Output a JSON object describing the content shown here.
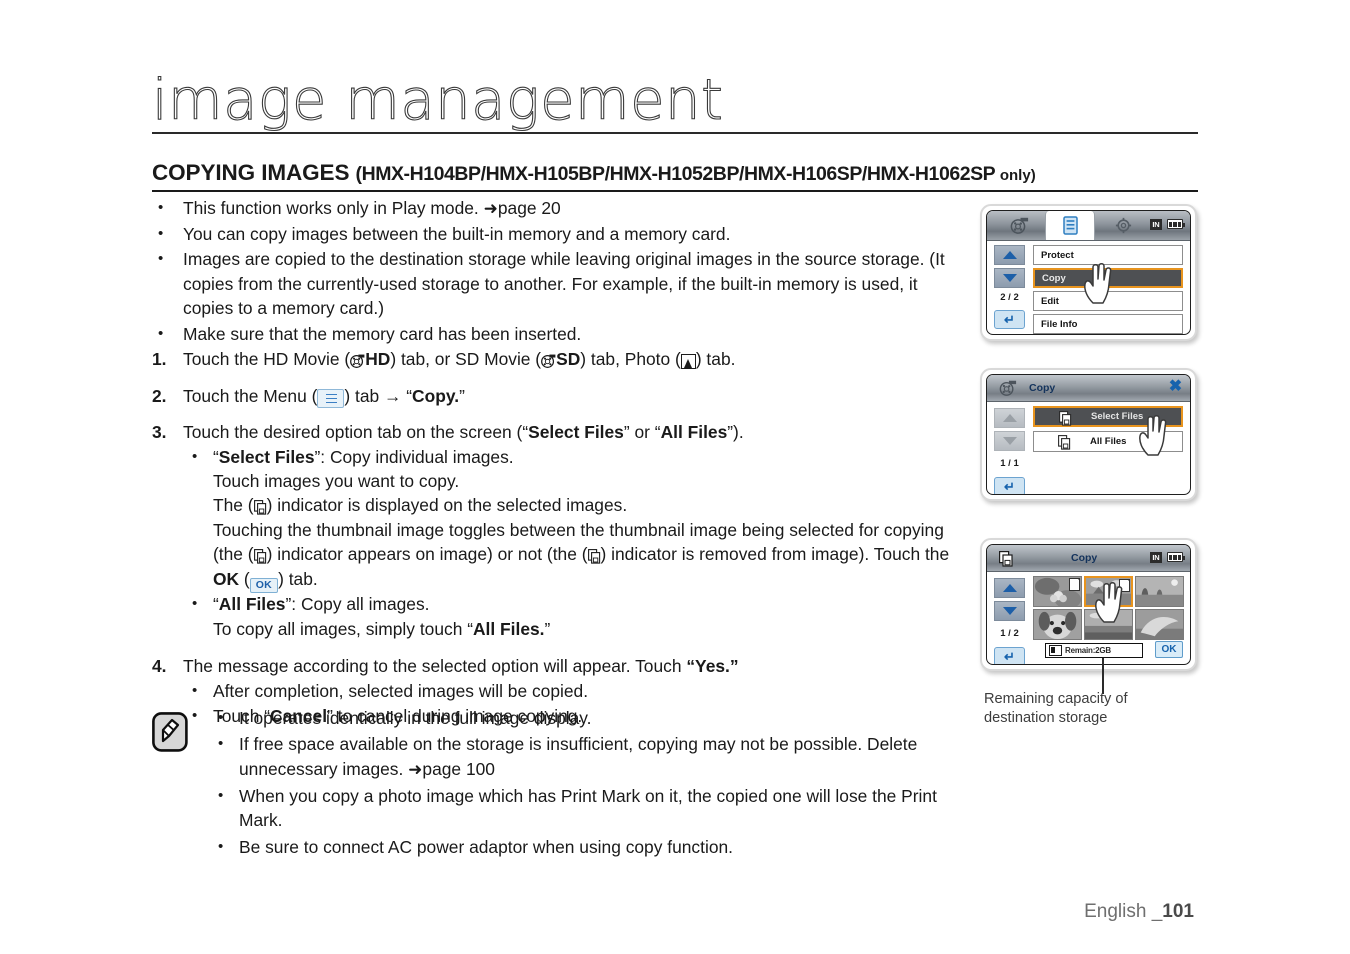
{
  "page": {
    "title": "image management",
    "section_heading_main": "COPYING IMAGES ",
    "section_heading_models": "(HMX-H104BP/HMX-H105BP/HMX-H1052BP/HMX-H106SP/HMX-H1062SP ",
    "section_heading_only": "only)",
    "footer_language": "English _",
    "footer_page": "101"
  },
  "intro_bullets": [
    {
      "pre": "This function works only in Play mode. ",
      "ref_arrow": "➜",
      "ref": "page 20"
    },
    {
      "pre": "You can copy images between the built-in memory and a memory card.",
      "ref_arrow": "",
      "ref": ""
    },
    {
      "pre": "Images are copied to the destination storage while leaving original images in the source storage. (It copies from the currently-used storage to another. For example, if the built-in memory is used, it copies to a memory card.)",
      "ref_arrow": "",
      "ref": ""
    },
    {
      "pre": "Make sure that the memory card has been inserted.",
      "ref_arrow": "",
      "ref": ""
    }
  ],
  "steps": {
    "s1": {
      "num": "1.",
      "t1": "Touch the HD Movie (",
      "hd_label": "HD",
      "t2": ") tab, or SD Movie (",
      "sd_label": "SD",
      "t3": ") tab, Photo (",
      "t4": ") tab."
    },
    "s2": {
      "num": "2.",
      "t1": "Touch the Menu (",
      "t2": ") tab ",
      "arrow": "→",
      "t3": " “",
      "copy_label": "Copy.",
      "t4": "”"
    },
    "s3": {
      "num": "3.",
      "t1": "Touch the desired option tab on the screen (“",
      "select_files": "Select Files",
      "t2": "” or “",
      "all_files": "All Files",
      "t3": "”).",
      "sub1": {
        "q1": "“",
        "bold1": "Select Files",
        "q2": "”: Copy individual images.",
        "line2": "Touch images you want to copy.",
        "line3a": "The (",
        "line3b": ") indicator is displayed on the selected images.",
        "line4a": "Touching the thumbnail image toggles between the thumbnail image being selected for copying (the (",
        "line4b": ") indicator appears on image) or not (the (",
        "line4c": ") indicator is removed from image). Touch the ",
        "ok_bold": "OK",
        "line4d": " (",
        "ok_tab": "OK",
        "line4e": ") tab."
      },
      "sub2": {
        "q1": "“",
        "bold1": "All Files",
        "q2": "”: Copy all images.",
        "line2a": "To copy all images, simply touch “",
        "bold2": "All Files.",
        "line2b": "”"
      }
    },
    "s4": {
      "num": "4.",
      "t1": "The message according to the selected option will appear. Touch ",
      "yes": "“Yes.”",
      "sub1": "After completion, selected images will be copied.",
      "sub2a": "Touch “",
      "sub2_bold": "Cancel",
      "sub2b": "” to cancel during image copying."
    }
  },
  "notes": [
    {
      "a": "It operates identically in the full image display.",
      "b": "",
      "arrow": "",
      "ref": ""
    },
    {
      "a": "If free space available on the storage is insufficient, copying may not be possible. Delete unnecessary images. ",
      "b": "",
      "arrow": "➜",
      "ref": "page 100"
    },
    {
      "a": "When you copy a photo image which has Print Mark on it, the copied one will lose the Print Mark.",
      "b": "",
      "arrow": "",
      "ref": ""
    },
    {
      "a": "Be sure to connect AC power adaptor when using copy function.",
      "b": "",
      "arrow": "",
      "ref": ""
    }
  ],
  "lcd_menu": {
    "status_memory": "IN",
    "page_indicator": "2 / 2",
    "items": [
      {
        "label": "Protect",
        "highlighted": false
      },
      {
        "label": "Copy",
        "highlighted": true
      },
      {
        "label": "Edit",
        "highlighted": false
      },
      {
        "label": "File Info",
        "highlighted": false
      }
    ]
  },
  "lcd_copy": {
    "title": "Copy",
    "page_indicator": "1 / 1",
    "options": [
      {
        "label": "Select Files",
        "highlighted": true
      },
      {
        "label": "All Files",
        "highlighted": false
      }
    ]
  },
  "lcd_thumbs": {
    "title": "Copy",
    "status_memory": "IN",
    "page_indicator": "1 / 2",
    "remaining_text": "Remain:2GB",
    "ok_label": "OK",
    "thumbnails": [
      {
        "selected": false,
        "badge": true
      },
      {
        "selected": true,
        "badge": true
      },
      {
        "selected": false,
        "badge": false
      },
      {
        "selected": false,
        "badge": false
      },
      {
        "selected": false,
        "badge": false
      },
      {
        "selected": false,
        "badge": false
      }
    ]
  },
  "callout": {
    "line1": "Remaining capacity of",
    "line2": "destination storage"
  },
  "colors": {
    "highlight_orange": "#e8941e",
    "accent_blue": "#1763ad",
    "menu_dark": "#4e5053"
  }
}
